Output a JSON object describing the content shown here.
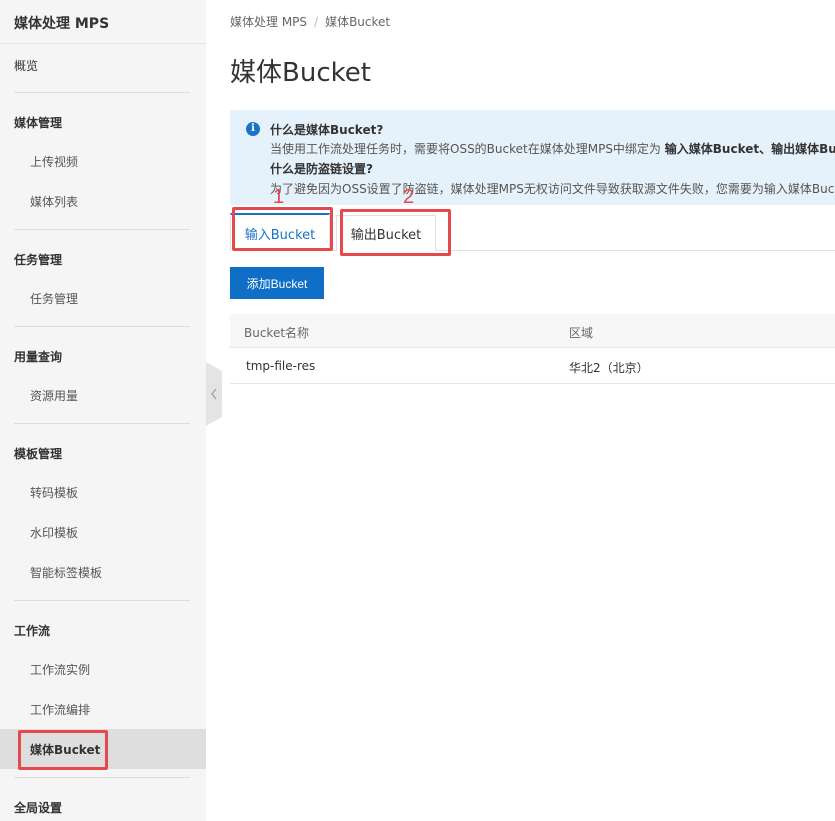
{
  "sidebar": {
    "title": "媒体处理 MPS",
    "overview": "概览",
    "groups": [
      {
        "label": "媒体管理",
        "items": [
          "上传视频",
          "媒体列表"
        ]
      },
      {
        "label": "任务管理",
        "items": [
          "任务管理"
        ]
      },
      {
        "label": "用量查询",
        "items": [
          "资源用量"
        ]
      },
      {
        "label": "模板管理",
        "items": [
          "转码模板",
          "水印模板",
          "智能标签模板"
        ]
      },
      {
        "label": "工作流",
        "items": [
          "工作流实例",
          "工作流编排",
          "媒体Bucket"
        ]
      },
      {
        "label": "全局设置",
        "items": []
      }
    ]
  },
  "breadcrumb": {
    "root": "媒体处理 MPS",
    "separator": "/",
    "current": "媒体Bucket"
  },
  "page": {
    "title": "媒体Bucket"
  },
  "info": {
    "icon": "info-icon",
    "q1": "什么是媒体Bucket?",
    "a1_text": "当使用工作流处理任务时，需要将OSS的Bucket在媒体处理MPS中绑定为",
    "a1_bold": "输入媒体Bucket、输出媒体Bucke",
    "q2": "什么是防盗链设置?",
    "a2": "为了避免因为OSS设置了防盗链，媒体处理MPS无权访问文件导致获取源文件失败，您需要为输入媒体Bucke"
  },
  "tabs": {
    "input": "输入Bucket",
    "output": "输出Bucket"
  },
  "toolbar": {
    "add_label": "添加Bucket"
  },
  "table": {
    "columns": [
      "Bucket名称",
      "区域"
    ],
    "rows": [
      [
        "tmp-file-res",
        "华北2（北京）"
      ]
    ]
  },
  "annotations": {
    "one": "1",
    "two": "2"
  },
  "colors": {
    "accent": "#1a73c4",
    "primary_button": "#0f6fc6",
    "annotation": "#e5484d",
    "info_bg": "#e5f1fb"
  }
}
